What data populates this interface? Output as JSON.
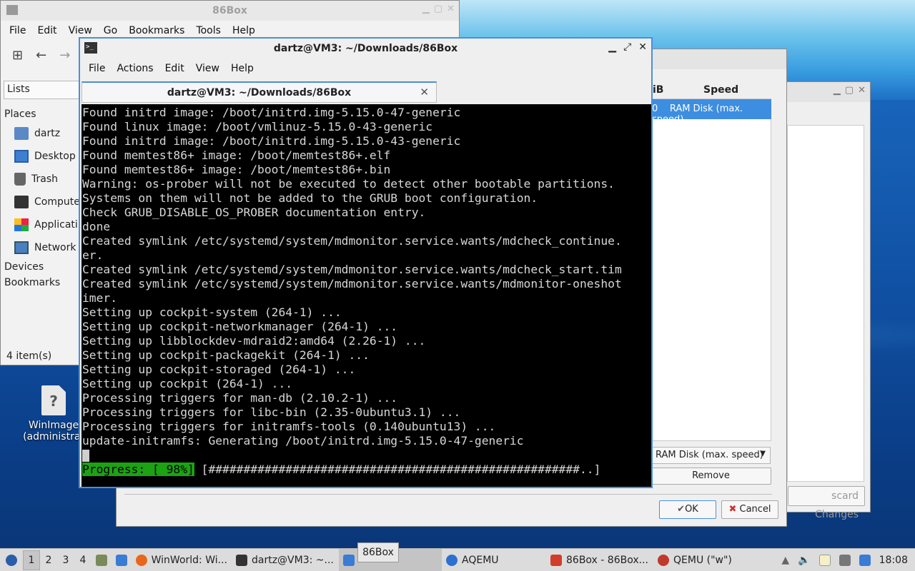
{
  "file_manager": {
    "title": "86Box",
    "menu": [
      "File",
      "Edit",
      "View",
      "Go",
      "Bookmarks",
      "Tools",
      "Help"
    ],
    "lists_label": "Lists",
    "places_header": "Places",
    "places": [
      "dartz",
      "Desktop",
      "Trash",
      "Compute",
      "Applicati",
      "Network"
    ],
    "devices_header": "Devices",
    "bookmarks_header": "Bookmarks",
    "status": "4 item(s)"
  },
  "dialog": {
    "col_mib": "iB",
    "col_speed": "Speed",
    "row_prefix": "0",
    "row_speed": "RAM Disk (max. speed)",
    "speed_dropdown": "RAM Disk (max. speed)",
    "remove_label": "Remove",
    "discard_label": "scard Changes",
    "ok_label": "OK",
    "cancel_label": "Cancel"
  },
  "desktop_icon": {
    "line1": "WinImage",
    "line2": "(administrat"
  },
  "terminal": {
    "title": "dartz@VM3: ~/Downloads/86Box",
    "menu": [
      "File",
      "Actions",
      "Edit",
      "View",
      "Help"
    ],
    "tab_title": "dartz@VM3: ~/Downloads/86Box",
    "lines": [
      "Found initrd image: /boot/initrd.img-5.15.0-47-generic",
      "Found linux image: /boot/vmlinuz-5.15.0-43-generic",
      "Found initrd image: /boot/initrd.img-5.15.0-43-generic",
      "Found memtest86+ image: /boot/memtest86+.elf",
      "Found memtest86+ image: /boot/memtest86+.bin",
      "Warning: os-prober will not be executed to detect other bootable partitions.",
      "Systems on them will not be added to the GRUB boot configuration.",
      "Check GRUB_DISABLE_OS_PROBER documentation entry.",
      "done",
      "Created symlink /etc/systemd/system/mdmonitor.service.wants/mdcheck_continue.",
      "er.",
      "Created symlink /etc/systemd/system/mdmonitor.service.wants/mdcheck_start.tim",
      "Created symlink /etc/systemd/system/mdmonitor.service.wants/mdmonitor-oneshot",
      "imer.",
      "Setting up cockpit-system (264-1) ...",
      "Setting up cockpit-networkmanager (264-1) ...",
      "Setting up libblockdev-mdraid2:amd64 (2.26-1) ...",
      "Setting up cockpit-packagekit (264-1) ...",
      "Setting up cockpit-storaged (264-1) ...",
      "Setting up cockpit (264-1) ...",
      "Processing triggers for man-db (2.10.2-1) ...",
      "Processing triggers for libc-bin (2.35-0ubuntu3.1) ...",
      "Processing triggers for initramfs-tools (0.140ubuntu13) ...",
      "update-initramfs: Generating /boot/initrd.img-5.15.0-47-generic"
    ],
    "progress_label": "Progress: [ 98%]",
    "progress_percent": 98,
    "progress_bar": " [#####################################################..]"
  },
  "taskbar": {
    "workspaces": [
      "1",
      "2",
      "3",
      "4"
    ],
    "tasks": [
      {
        "label": "WinWorld: Wi...",
        "icon": "firefox-icon",
        "color": "#e8661c"
      },
      {
        "label": "dartz@VM3: ~...",
        "icon": "terminal-icon",
        "color": "#333333"
      },
      {
        "label": "",
        "icon": "folder-icon",
        "color": "#3a7bd5"
      },
      {
        "label": "AQEMU",
        "icon": "aqemu-icon",
        "color": "#2e6fd0"
      },
      {
        "label": "86Box - 86Box...",
        "icon": "86box-icon",
        "color": "#d23c2a"
      },
      {
        "label": "QEMU (\"w\")",
        "icon": "qemu-icon",
        "color": "#c0392b"
      }
    ],
    "tooltip": "86Box",
    "clock": "18:08"
  }
}
